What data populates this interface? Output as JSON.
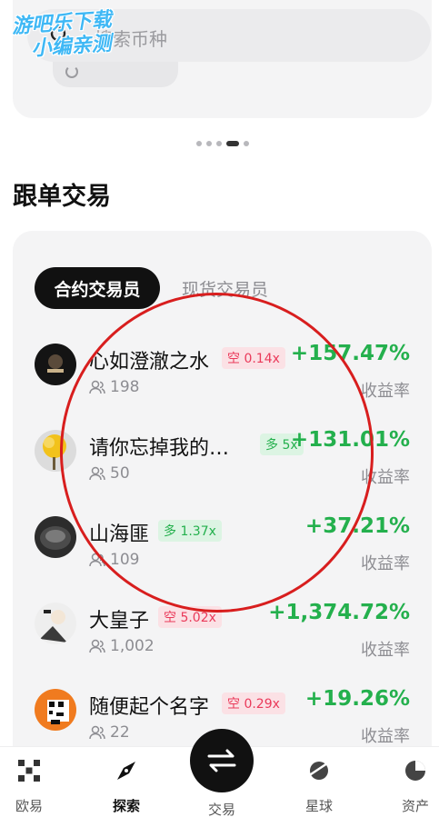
{
  "search": {
    "placeholder": "搜索币种"
  },
  "watermark": {
    "line1": "游吧乐下载",
    "line2": "小编亲测"
  },
  "section": {
    "title": "跟单交易"
  },
  "tabs": [
    {
      "label": "合约交易员",
      "active": true
    },
    {
      "label": "现货交易员",
      "active": false
    }
  ],
  "traders": [
    {
      "name": "心如澄澈之水",
      "badge": "空 0.14x",
      "side": "short",
      "followers": "198",
      "pnl": "+157.47%",
      "pnl_label": "收益率"
    },
    {
      "name": "请你忘掉我的…",
      "badge": "多 5x",
      "side": "long",
      "followers": "50",
      "pnl": "+131.01%",
      "pnl_label": "收益率"
    },
    {
      "name": "山海匪",
      "badge": "多 1.37x",
      "side": "long",
      "followers": "109",
      "pnl": "+37.21%",
      "pnl_label": "收益率"
    },
    {
      "name": "大皇子",
      "badge": "空 5.02x",
      "side": "short",
      "followers": "1,002",
      "pnl": "+1,374.72%",
      "pnl_label": "收益率"
    },
    {
      "name": "随便起个名字",
      "badge": "空 0.29x",
      "side": "short",
      "followers": "22",
      "pnl": "+19.26%",
      "pnl_label": "收益率"
    }
  ],
  "nav": [
    {
      "label": "欧易",
      "icon": "okx-logo-icon"
    },
    {
      "label": "探索",
      "icon": "compass-icon",
      "active": true
    },
    {
      "label": "交易",
      "icon": "swap-arrows-icon"
    },
    {
      "label": "星球",
      "icon": "planet-icon"
    },
    {
      "label": "资产",
      "icon": "pie-chart-icon"
    }
  ],
  "colors": {
    "up_green": "#24b04d",
    "short_red": "#ea3a5a",
    "annotation_red": "#d81e1e"
  }
}
